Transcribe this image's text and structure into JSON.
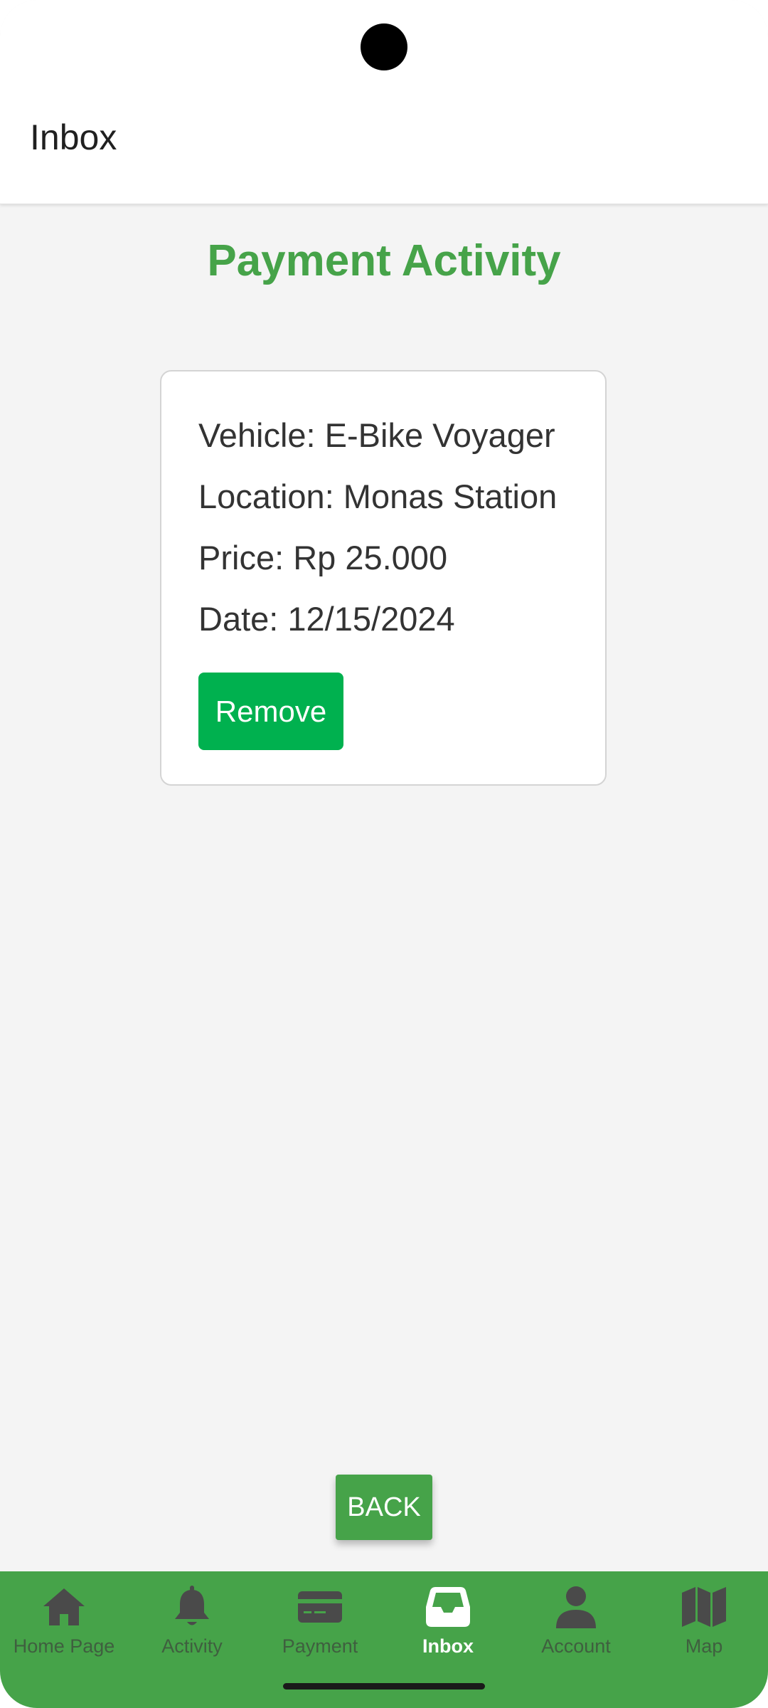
{
  "header": {
    "title": "Inbox"
  },
  "main": {
    "heading": "Payment Activity",
    "heading_color": "#46a349",
    "card": {
      "vehicle": "Vehicle: E-Bike Voyager",
      "location": "Location: Monas Station",
      "price": "Price: Rp 25.000",
      "date": "Date: 12/15/2024",
      "remove_label": "Remove",
      "remove_color": "#00b14f"
    },
    "back_label": "BACK"
  },
  "bottom_nav": {
    "background_color": "#46a349",
    "active_index": 3,
    "items": [
      {
        "label": "Home Page",
        "icon": "home-icon"
      },
      {
        "label": "Activity",
        "icon": "bell-icon"
      },
      {
        "label": "Payment",
        "icon": "credit-card-icon"
      },
      {
        "label": "Inbox",
        "icon": "inbox-icon"
      },
      {
        "label": "Account",
        "icon": "user-icon"
      },
      {
        "label": "Map",
        "icon": "map-icon"
      }
    ]
  }
}
